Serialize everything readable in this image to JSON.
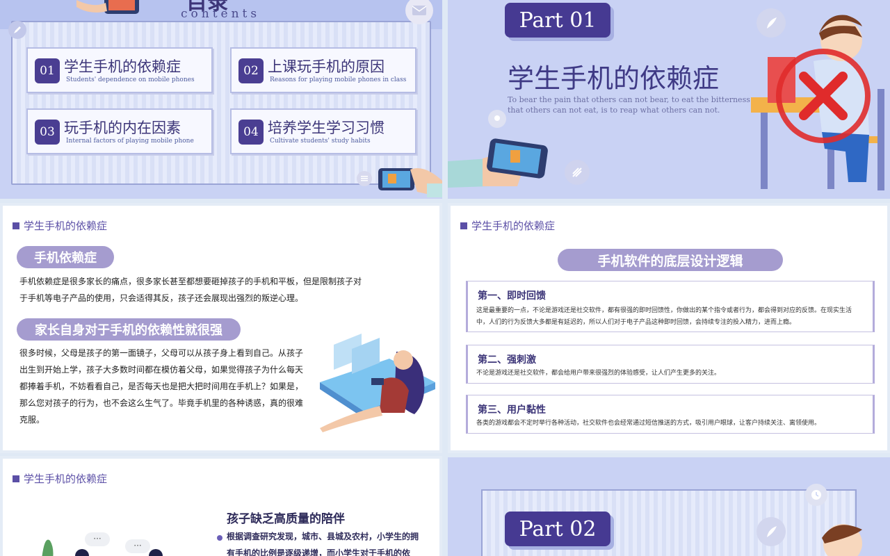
{
  "slide1": {
    "heading_fragment": "目录",
    "subtitle": "contents",
    "items": [
      {
        "num": "01",
        "title": "学生手机的依赖症",
        "sub": "Students' dependence on mobile phones"
      },
      {
        "num": "02",
        "title": "上课玩手机的原因",
        "sub": "Reasons for playing mobile phones in class"
      },
      {
        "num": "03",
        "title": "玩手机的内在因素",
        "sub": "Internal factors of playing mobile phone"
      },
      {
        "num": "04",
        "title": "培养学生学习习惯",
        "sub": "Cultivate students' study habits"
      }
    ]
  },
  "slide2": {
    "part": "Part 01",
    "title": "学生手机的依赖症",
    "desc_line1": "To bear the pain that others can not bear, to eat the bitterness",
    "desc_line2": "that others can not eat, is to reap what others can not."
  },
  "slide3": {
    "section": "学生手机的依赖症",
    "pill1": "手机依赖症",
    "para1_line1": "手机依赖症是很多家长的痛点，很多家长甚至都想要砸掉孩子的手机和平板，但是限制孩子对",
    "para1_line2": "于手机等电子产品的使用，只会适得其反，孩子还会展现出强烈的叛逆心理。",
    "pill2": "家长自身对于手机的依赖性就很强",
    "para2_lines": [
      "很多时候，父母是孩子的第一面镜子，父母可以从孩子身上看到自己。从孩子",
      "出生到开始上学，孩子大多数时间都在模仿着父母，如果觉得孩子为什么每天",
      "都捧着手机，不妨看看自己，是否每天也是把大把时间用在手机上？如果是，",
      "那么您对孩子的行为，也不会这么生气了。毕竟手机里的各种诱惑，真的很难",
      "克服。"
    ]
  },
  "slide4": {
    "section": "学生手机的依赖症",
    "pill": "手机软件的底层设计逻辑",
    "cards": [
      {
        "title": "第一、即时回馈",
        "lines": [
          "这是最重要的一点，不论是游戏还是社交软件，都有很强的即时回馈性，你做出的某个指令或者行为，都会得到对应的反馈。在现实生活",
          "中，人们的行为反馈大多都是有延迟的，所以人们对于电子产品这种即时回馈，会持续专注的投入精力，进而上瘾。"
        ]
      },
      {
        "title": "第二、强刺激",
        "lines": [
          "不论是游戏还是社交软件，都会给用户带来很强烈的体验感受，让人们产生更多的关注。"
        ]
      },
      {
        "title": "第三、用户黏性",
        "lines": [
          "各类的游戏都会不定时举行各种活动，社交软件也会经常通过短信推送的方式，吸引用户眼球，让客户持续关注、离领使用。"
        ]
      }
    ]
  },
  "slide5": {
    "section": "学生手机的依赖症",
    "title": "孩子缺乏高质量的陪伴",
    "bullet_line1": "根据调查研究发现，城市、县城及农村，小学生的拥",
    "bullet_line2": "有手机的比例是逐级递增，而小学生对于手机的依",
    "bubble": "···"
  },
  "slide6": {
    "part": "Part 02"
  },
  "colors": {
    "accent": "#463a92",
    "pill": "#a59ccf",
    "section": "#5b4fa6",
    "bg": "#c9d2f4"
  },
  "icons": [
    "pen-icon",
    "mail-icon",
    "chat-icon",
    "feather-icon",
    "pin-icon",
    "wifi-icon",
    "clock-icon",
    "phone-illustration",
    "student-illustration",
    "girl-illustration",
    "cross-icon"
  ]
}
